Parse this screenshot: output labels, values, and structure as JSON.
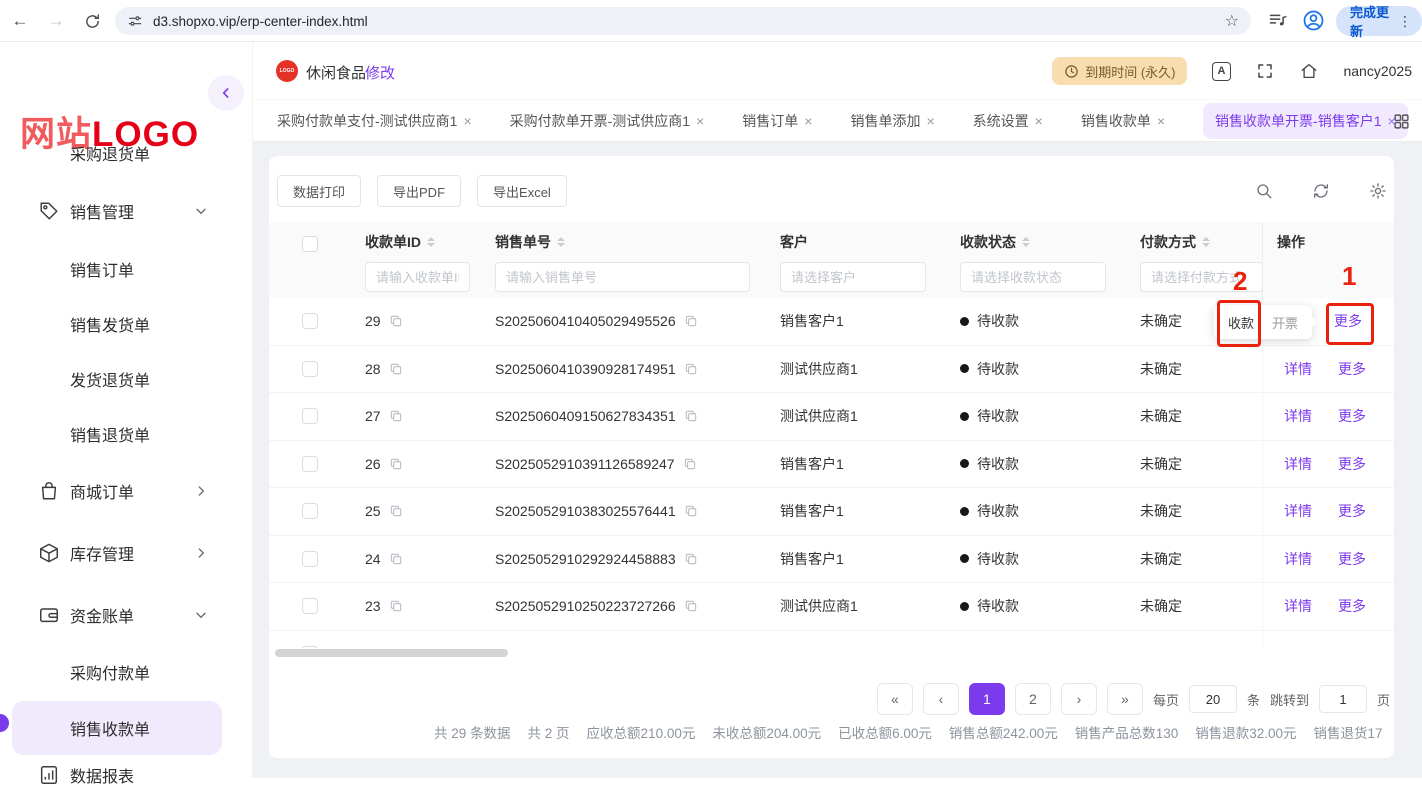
{
  "browser": {
    "url": "d3.shopxo.vip/erp-center-index.html",
    "update_button": "完成更新"
  },
  "sidebar": {
    "logo_primary": "网站",
    "logo_secondary": "LOGO",
    "items": [
      {
        "label": "采购退货单",
        "type": "sub"
      },
      {
        "label": "销售管理",
        "type": "parent",
        "icon": "tag-icon",
        "chevron": "down"
      },
      {
        "label": "销售订单",
        "type": "sub"
      },
      {
        "label": "销售发货单",
        "type": "sub"
      },
      {
        "label": "发货退货单",
        "type": "sub"
      },
      {
        "label": "销售退货单",
        "type": "sub"
      },
      {
        "label": "商城订单",
        "type": "parent",
        "icon": "bag-icon",
        "chevron": "right"
      },
      {
        "label": "库存管理",
        "type": "parent",
        "icon": "box-icon",
        "chevron": "right"
      },
      {
        "label": "资金账单",
        "type": "parent",
        "icon": "wallet-icon",
        "chevron": "down"
      },
      {
        "label": "采购付款单",
        "type": "sub"
      },
      {
        "label": "销售收款单",
        "type": "sub",
        "selected": true
      },
      {
        "label": "数据报表",
        "type": "parent",
        "icon": "report-icon",
        "partial": true
      }
    ]
  },
  "header": {
    "store_name": "休闲食品",
    "edit_link": "修改",
    "expiry_badge": "到期时间 (永久)",
    "username": "nancy2025"
  },
  "tabs": {
    "close_glyph": "×",
    "items": [
      {
        "label": "采购付款单支付-测试供应商1",
        "active": false
      },
      {
        "label": "采购付款单开票-测试供应商1",
        "active": false
      },
      {
        "label": "销售订单",
        "active": false
      },
      {
        "label": "销售单添加",
        "active": false
      },
      {
        "label": "系统设置",
        "active": false
      },
      {
        "label": "销售收款单",
        "active": false
      },
      {
        "label": "销售收款单开票-销售客户1",
        "active": true
      }
    ]
  },
  "toolbar": {
    "buttons": [
      "数据打印",
      "导出PDF",
      "导出Excel"
    ]
  },
  "table": {
    "columns": [
      {
        "label": "收款单ID",
        "sortable": true,
        "placeholder": "请输入收款单ID"
      },
      {
        "label": "销售单号",
        "sortable": true,
        "placeholder": "请输入销售单号"
      },
      {
        "label": "客户",
        "sortable": false,
        "placeholder": "请选择客户"
      },
      {
        "label": "收款状态",
        "sortable": true,
        "placeholder": "请选择收款状态"
      },
      {
        "label": "付款方式",
        "sortable": true,
        "placeholder": "请选择付款方式"
      },
      {
        "label": "操作",
        "sortable": false,
        "placeholder": ""
      }
    ],
    "rows": [
      {
        "id": "29",
        "order_no": "S2025060410405029495526",
        "customer": "销售客户1",
        "status": "待收款",
        "payment": "未确定",
        "actions": "popup"
      },
      {
        "id": "28",
        "order_no": "S2025060410390928174951",
        "customer": "测试供应商1",
        "status": "待收款",
        "payment": "未确定",
        "actions": "default"
      },
      {
        "id": "27",
        "order_no": "S2025060409150627834351",
        "customer": "测试供应商1",
        "status": "待收款",
        "payment": "未确定",
        "actions": "default"
      },
      {
        "id": "26",
        "order_no": "S2025052910391126589247",
        "customer": "销售客户1",
        "status": "待收款",
        "payment": "未确定",
        "actions": "default"
      },
      {
        "id": "25",
        "order_no": "S2025052910383025576441",
        "customer": "销售客户1",
        "status": "待收款",
        "payment": "未确定",
        "actions": "default"
      },
      {
        "id": "24",
        "order_no": "S2025052910292924458883",
        "customer": "销售客户1",
        "status": "待收款",
        "payment": "未确定",
        "actions": "default"
      },
      {
        "id": "23",
        "order_no": "S2025052910250223727266",
        "customer": "测试供应商1",
        "status": "待收款",
        "payment": "未确定",
        "actions": "default"
      }
    ],
    "action_detail": "详情",
    "action_more": "更多",
    "popup": {
      "receive": "收款",
      "invoice": "开票"
    }
  },
  "pagination": {
    "first": "«",
    "prev": "‹",
    "pages": [
      "1",
      "2"
    ],
    "active_page": "1",
    "next": "›",
    "last": "»",
    "per_page_label": "每页",
    "per_page_value": "20",
    "per_page_unit": "条",
    "jump_label": "跳转到",
    "jump_value": "1",
    "jump_unit": "页"
  },
  "summary": {
    "parts": [
      "共 29 条数据",
      "共 2 页",
      "应收总额210.00元",
      "未收总额204.00元",
      "已收总额6.00元",
      "销售总额242.00元",
      "销售产品总数130",
      "销售退款32.00元",
      "销售退货17"
    ]
  },
  "annotations": {
    "label_1": "1",
    "label_2": "2"
  },
  "colors": {
    "accent": "#7c3aed",
    "logo_red": "#e60017",
    "annotation_red": "#e8220c",
    "badge_bg": "#f7ddb0"
  }
}
